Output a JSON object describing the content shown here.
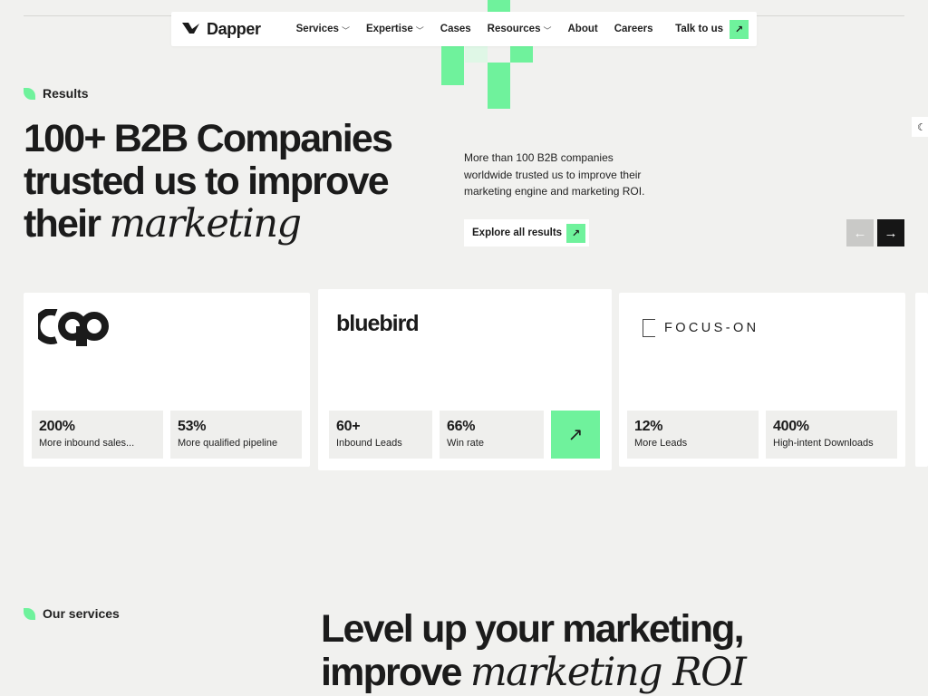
{
  "nav": {
    "brand": "Dapper",
    "items": [
      {
        "label": "Services",
        "has_dropdown": true
      },
      {
        "label": "Expertise",
        "has_dropdown": true
      },
      {
        "label": "Cases",
        "has_dropdown": false
      },
      {
        "label": "Resources",
        "has_dropdown": true
      },
      {
        "label": "About",
        "has_dropdown": false
      },
      {
        "label": "Careers",
        "has_dropdown": false
      }
    ],
    "cta_label": "Talk to us",
    "cta_icon": "arrow-up-right-icon"
  },
  "results": {
    "eyebrow": "Results",
    "title_line1": "100+ B2B Companies",
    "title_line2": "trusted us to improve",
    "title_line3_plain": "their ",
    "title_line3_italic": "marketing",
    "description": "More than 100 B2B companies worldwide trusted us to improve their marketing engine and marketing ROI.",
    "explore_label": "Explore all results",
    "prev_icon": "arrow-left-icon",
    "next_icon": "arrow-right-icon"
  },
  "theme_toggle_icon": "moon-icon",
  "cases": [
    {
      "logo": "cqp",
      "stats": [
        {
          "value": "200%",
          "label": "More inbound sales..."
        },
        {
          "value": "53%",
          "label": "More qualified pipeline"
        }
      ]
    },
    {
      "logo": "bluebird",
      "stats": [
        {
          "value": "60+",
          "label": "Inbound Leads"
        },
        {
          "value": "66%",
          "label": "Win rate"
        }
      ],
      "arrow_icon": "arrow-up-right-icon"
    },
    {
      "logo": "FOCUS-ON",
      "stats": [
        {
          "value": "12%",
          "label": "More Leads"
        },
        {
          "value": "400%",
          "label": "High-intent Downloads"
        }
      ]
    }
  ],
  "services": {
    "eyebrow": "Our services",
    "title_line1": "Level up your marketing,",
    "title_line2_plain": "improve ",
    "title_line2_italic": "marketing ROI"
  },
  "colors": {
    "accent": "#6ff29c",
    "background": "#f1f1ef",
    "text": "#1b1b1b",
    "card": "#ffffff",
    "stat_bg": "#efefed"
  }
}
